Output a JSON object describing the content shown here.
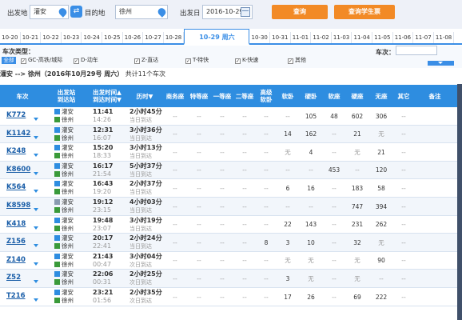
{
  "search": {
    "from_label": "出发地",
    "from_value": "灌安",
    "to_label": "目的地",
    "to_value": "徐州",
    "date_label": "出发日",
    "date_value": "2016-10-29",
    "swap_icon": "swap-icon",
    "query_button": "查询",
    "student_button": "查询学生票"
  },
  "date_tabs": [
    {
      "label": "10-20"
    },
    {
      "label": "10-21"
    },
    {
      "label": "10-22"
    },
    {
      "label": "10-23"
    },
    {
      "label": "10-24"
    },
    {
      "label": "10-25"
    },
    {
      "label": "10-26"
    },
    {
      "label": "10-27"
    },
    {
      "label": "10-28"
    },
    {
      "label": "10-29 周六",
      "active": true
    },
    {
      "label": "10-30"
    },
    {
      "label": "10-31"
    },
    {
      "label": "11-01"
    },
    {
      "label": "11-02"
    },
    {
      "label": "11-03"
    },
    {
      "label": "11-04"
    },
    {
      "label": "11-05"
    },
    {
      "label": "11-06"
    },
    {
      "label": "11-07"
    },
    {
      "label": "11-08"
    }
  ],
  "filter": {
    "title": "车次类型：",
    "all": "全部",
    "types": [
      "GC-高铁/城际",
      "D-动车",
      "Z-直达",
      "T-特快",
      "K-快速",
      "其他"
    ],
    "train_no_label": "车次："
  },
  "route": {
    "text": "灌安 --> 徐州（2016年10月29号  周六）",
    "count_text": "共计11个车次"
  },
  "headers": {
    "train": "车次",
    "stations": "出发站\n到达站",
    "times": "出发时间▲\n到达时间▼",
    "duration": "历时▼",
    "business": "商务座",
    "special": "特等座",
    "first": "一等座",
    "second": "二等座",
    "adv_soft": "高级\n软卧",
    "soft_sleeper": "软卧",
    "hard_sleeper": "硬卧",
    "soft_seat": "软座",
    "hard_seat": "硬座",
    "no_seat": "无座",
    "other": "其它",
    "note": "备注"
  },
  "trains": [
    {
      "no": "K772",
      "from": "灌安",
      "to": "徐州",
      "from_type": "start",
      "dep": "11:41",
      "arr": "14:26",
      "dur": "2小时45分",
      "day": "当日到达",
      "seats": [
        "--",
        "--",
        "--",
        "--",
        "--",
        "--",
        "105",
        "48",
        "602",
        "306",
        "--"
      ]
    },
    {
      "no": "K1142",
      "from": "灌安",
      "to": "徐州",
      "from_type": "start",
      "dep": "12:31",
      "arr": "16:07",
      "dur": "3小时36分",
      "day": "当日到达",
      "seats": [
        "--",
        "--",
        "--",
        "--",
        "--",
        "14",
        "162",
        "--",
        "21",
        "无",
        "--"
      ]
    },
    {
      "no": "K248",
      "from": "灌安",
      "to": "徐州",
      "from_type": "start",
      "dep": "15:20",
      "arr": "18:33",
      "dur": "3小时13分",
      "day": "当日到达",
      "seats": [
        "--",
        "--",
        "--",
        "--",
        "--",
        "无",
        "4",
        "--",
        "无",
        "21",
        "--"
      ]
    },
    {
      "no": "K8600",
      "from": "灌安",
      "to": "徐州",
      "from_type": "start",
      "dep": "16:17",
      "arr": "21:54",
      "dur": "5小时37分",
      "day": "当日到达",
      "seats": [
        "--",
        "--",
        "--",
        "--",
        "--",
        "--",
        "--",
        "453",
        "--",
        "120",
        "--"
      ]
    },
    {
      "no": "K564",
      "from": "灌安",
      "to": "徐州",
      "from_type": "start",
      "dep": "16:43",
      "arr": "19:20",
      "dur": "2小时37分",
      "day": "当日到达",
      "seats": [
        "--",
        "--",
        "--",
        "--",
        "--",
        "6",
        "16",
        "--",
        "183",
        "58",
        "--"
      ]
    },
    {
      "no": "K8598",
      "from": "灌安",
      "to": "徐州",
      "from_type": "pass",
      "dep": "19:12",
      "arr": "23:15",
      "dur": "4小时03分",
      "day": "当日到达",
      "seats": [
        "--",
        "--",
        "--",
        "--",
        "--",
        "--",
        "--",
        "--",
        "747",
        "394",
        "--"
      ]
    },
    {
      "no": "K418",
      "from": "灌安",
      "to": "徐州",
      "from_type": "start",
      "dep": "19:48",
      "arr": "23:07",
      "dur": "3小时19分",
      "day": "当日到达",
      "seats": [
        "--",
        "--",
        "--",
        "--",
        "--",
        "22",
        "143",
        "--",
        "231",
        "262",
        "--"
      ]
    },
    {
      "no": "Z156",
      "from": "灌安",
      "to": "徐州",
      "from_type": "start",
      "dep": "20:17",
      "arr": "22:41",
      "dur": "2小时24分",
      "day": "当日到达",
      "seats": [
        "--",
        "--",
        "--",
        "--",
        "8",
        "3",
        "10",
        "--",
        "32",
        "无",
        "--"
      ]
    },
    {
      "no": "Z140",
      "from": "灌安",
      "to": "徐州",
      "from_type": "start",
      "dep": "21:43",
      "arr": "00:47",
      "dur": "3小时04分",
      "day": "次日到达",
      "seats": [
        "--",
        "--",
        "--",
        "--",
        "--",
        "无",
        "无",
        "--",
        "无",
        "90",
        "--"
      ]
    },
    {
      "no": "Z52",
      "from": "灌安",
      "to": "徐州",
      "from_type": "start",
      "dep": "22:06",
      "arr": "00:31",
      "dur": "2小时25分",
      "day": "次日到达",
      "seats": [
        "--",
        "--",
        "--",
        "--",
        "--",
        "3",
        "无",
        "--",
        "无",
        "--",
        "--"
      ]
    },
    {
      "no": "T216",
      "from": "灌安",
      "to": "徐州",
      "from_type": "start",
      "dep": "23:21",
      "arr": "01:56",
      "dur": "2小时35分",
      "day": "次日到达",
      "seats": [
        "--",
        "--",
        "--",
        "--",
        "--",
        "17",
        "26",
        "--",
        "69",
        "222",
        "--"
      ]
    }
  ],
  "colors": {
    "accent": "#2e8de0",
    "orange": "#f28a26"
  }
}
